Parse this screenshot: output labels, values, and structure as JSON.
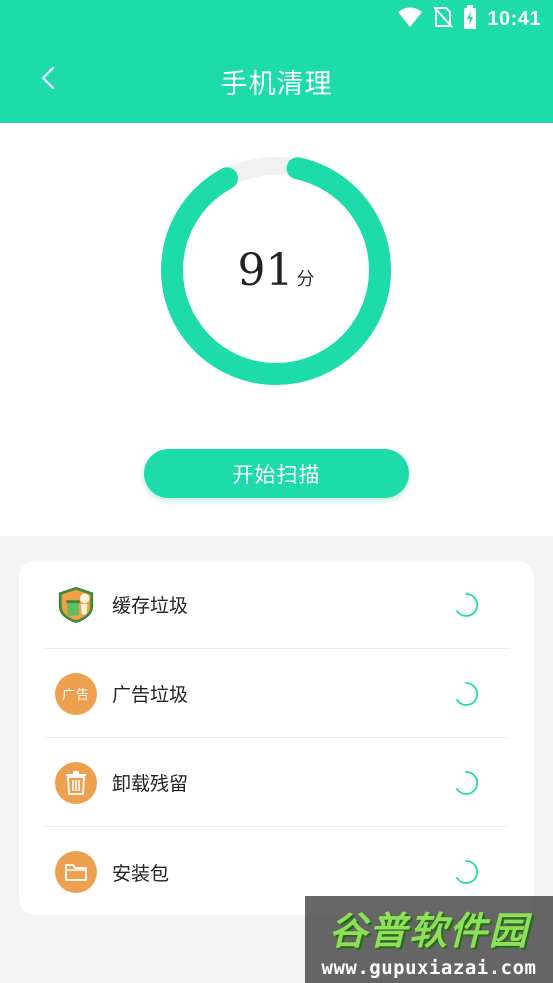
{
  "status_bar": {
    "time": "10:41",
    "icons": [
      "wifi-icon",
      "no-sim-icon",
      "battery-charging-icon"
    ]
  },
  "app_bar": {
    "title": "手机清理",
    "back_icon": "chevron-left-icon"
  },
  "score": {
    "value": "91",
    "unit": "分",
    "ring_fraction": 0.93,
    "ring_color": "#1ddcaa"
  },
  "scan_button": {
    "label": "开始扫描"
  },
  "cleanup_items": [
    {
      "label": "缓存垃圾",
      "icon": "cache-trash-badge-icon"
    },
    {
      "label": "广告垃圾",
      "icon": "ad-badge-icon",
      "badge_text": "广告"
    },
    {
      "label": "卸载残留",
      "icon": "trash-bin-icon"
    },
    {
      "label": "安装包",
      "icon": "folder-icon"
    }
  ],
  "colors": {
    "accent": "#1ddcaa",
    "icon_orange": "#eda050",
    "background": "#f4f4f4"
  },
  "watermark": {
    "title": "谷普软件园",
    "url": "www.gupuxiazai.com"
  }
}
